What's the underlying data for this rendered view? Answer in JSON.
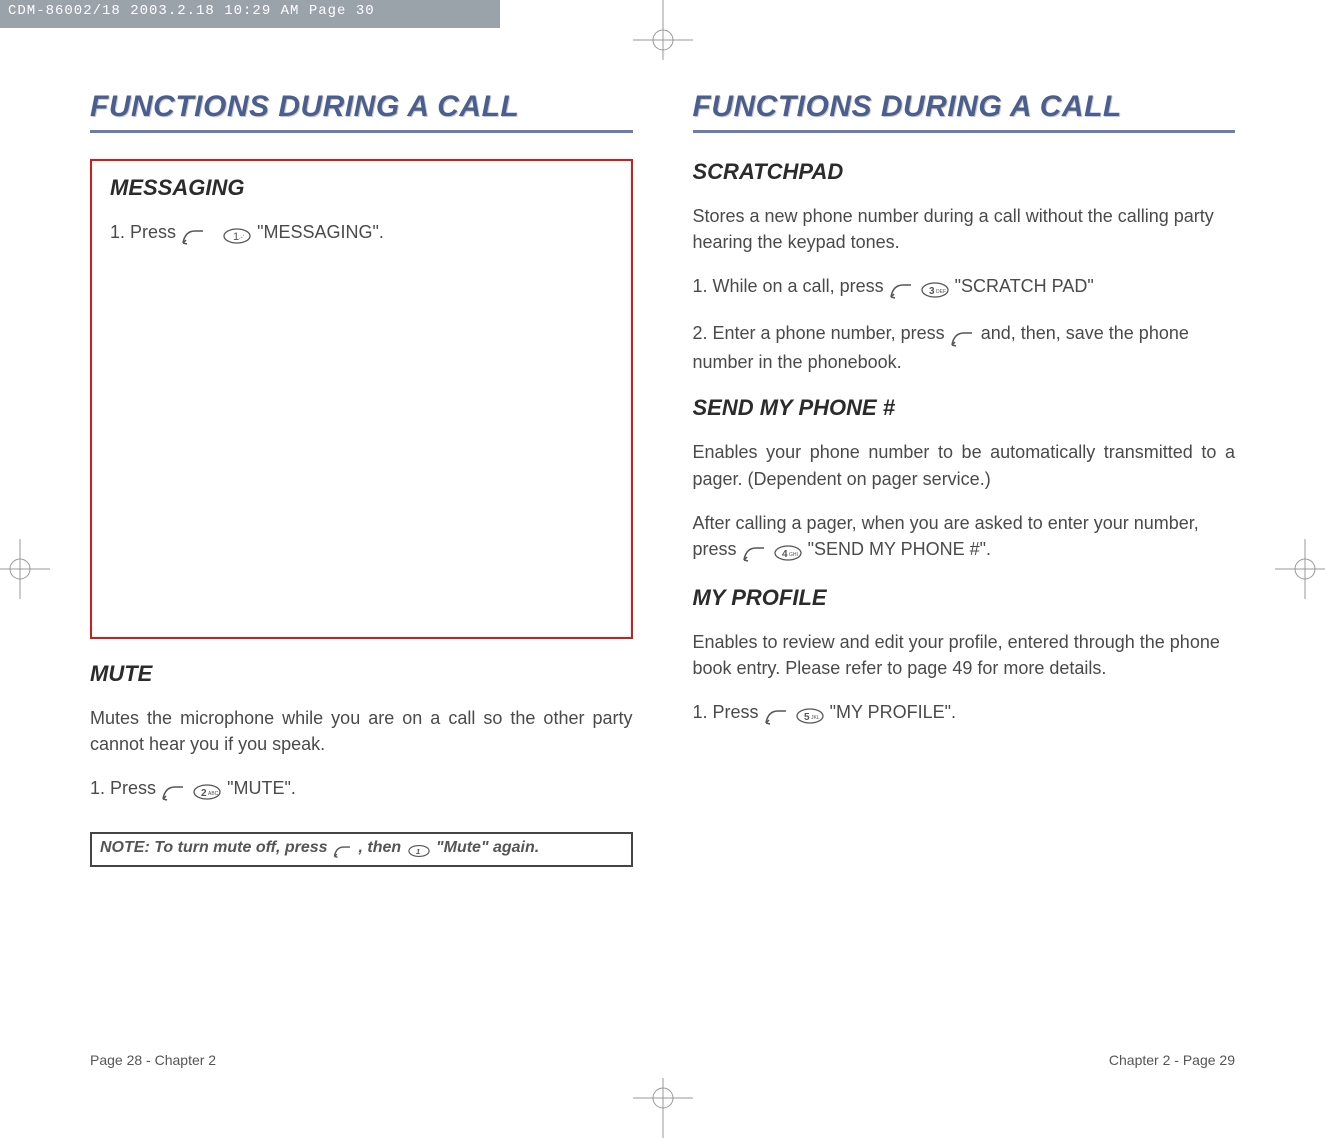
{
  "header_strip": "CDM-86002/18  2003.2.18  10:29 AM  Page 30",
  "left": {
    "chapter_title": "FUNCTIONS DURING A CALL",
    "section1_h": "MESSAGING",
    "section1_line_pre": "1. Press ",
    "section1_line_post": " \"MESSAGING\".",
    "section2_h": "MUTE",
    "section2_para": "Mutes the microphone while you are on a call so the other party cannot hear you if you speak.",
    "section2_step_pre": "1. Press ",
    "section2_step_post": " \"MUTE\".",
    "note_pre": "NOTE: To turn mute off, press ",
    "note_mid": " , then ",
    "note_post": " \"Mute\" again.",
    "footer": "Page 28 - Chapter 2"
  },
  "right": {
    "chapter_title": "FUNCTIONS DURING A CALL",
    "section1_h": "SCRATCHPAD",
    "section1_para": "Stores a new phone number during a call without the calling party hearing the keypad tones.",
    "section1_step_pre": "1. While on a call, press ",
    "section1_step_post": " \"SCRATCH PAD\"",
    "section1_step2_pre": "2. Enter a phone number, press ",
    "section1_step2_post": " and, then, save the phone number in the phonebook.",
    "section2_h": "SEND MY PHONE #",
    "section2_para": "Enables your phone number to be automatically transmitted to a pager. (Dependent on pager service.)",
    "section2_step_pre": "After calling a pager, when you are asked to enter your number, press ",
    "section2_step_post": " \"SEND MY PHONE #\".",
    "section3_h": "MY PROFILE",
    "section3_para": "Enables to review and edit your profile, entered through the phone book entry. Please refer to page 49 for more details.",
    "section3_step_pre": "1. Press ",
    "section3_step_post": " \"MY PROFILE\".",
    "footer": "Chapter 2 - Page 29"
  }
}
